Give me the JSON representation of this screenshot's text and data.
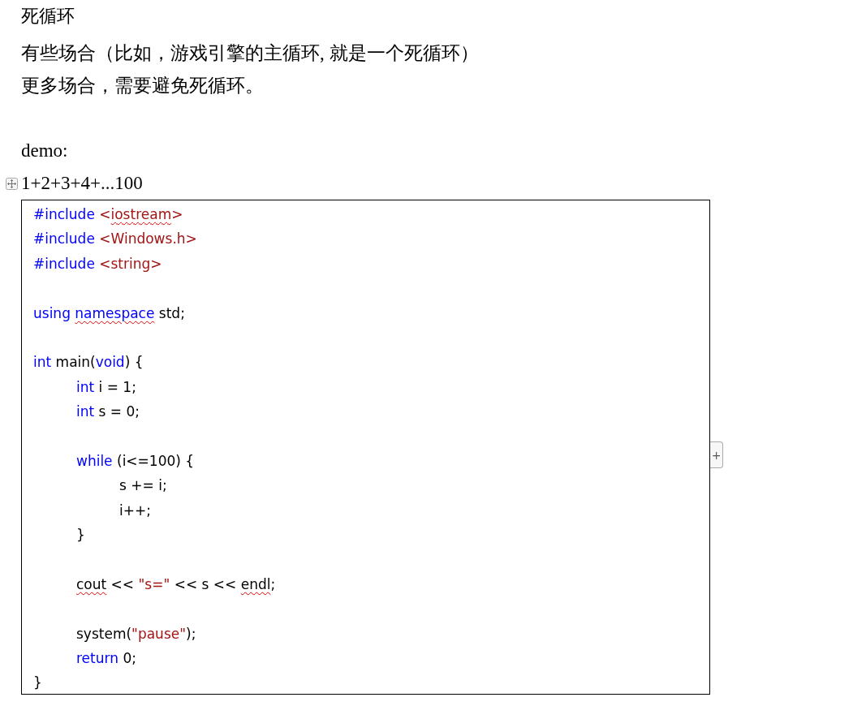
{
  "heading": "死循环",
  "paragraphs": [
    "有些场合（比如，游戏引擎的主循环, 就是一个死循环）",
    "更多场合，需要避免死循环。"
  ],
  "demo_label": "demo:",
  "formula": "1+2+3+4+...100",
  "table_handle": {
    "kind": "move"
  },
  "add_button": "+",
  "code": [
    {
      "kind": "code",
      "tokens": [
        {
          "t": "#include ",
          "kind": "keyword"
        },
        {
          "t": "<",
          "kind": "string"
        },
        {
          "t": "iostream",
          "kind": "string",
          "misspelled": true
        },
        {
          "t": ">",
          "kind": "string"
        }
      ]
    },
    {
      "kind": "code",
      "tokens": [
        {
          "t": "#include ",
          "kind": "keyword"
        },
        {
          "t": "<Windows.h>",
          "kind": "string"
        }
      ]
    },
    {
      "kind": "code",
      "tokens": [
        {
          "t": "#include ",
          "kind": "keyword"
        },
        {
          "t": "<string>",
          "kind": "string"
        }
      ]
    },
    {
      "kind": "blank"
    },
    {
      "kind": "code",
      "tokens": [
        {
          "t": "using ",
          "kind": "keyword"
        },
        {
          "t": "namespace",
          "kind": "keyword",
          "misspelled": true
        },
        {
          "t": " std;",
          "kind": "plain"
        }
      ]
    },
    {
      "kind": "blank"
    },
    {
      "kind": "code",
      "tokens": [
        {
          "t": "int",
          "kind": "keyword"
        },
        {
          "t": " main(",
          "kind": "plain"
        },
        {
          "t": "void",
          "kind": "keyword"
        },
        {
          "t": ") {",
          "kind": "plain"
        }
      ],
      "children": [
        {
          "kind": "code",
          "tokens": [
            {
              "t": "int",
              "kind": "keyword"
            },
            {
              "t": " i = 1;",
              "kind": "plain"
            }
          ]
        },
        {
          "kind": "code",
          "tokens": [
            {
              "t": "int",
              "kind": "keyword"
            },
            {
              "t": " s = 0;",
              "kind": "plain"
            }
          ]
        },
        {
          "kind": "blank"
        },
        {
          "kind": "code",
          "tokens": [
            {
              "t": "while",
              "kind": "keyword"
            },
            {
              "t": " (i<=100) {",
              "kind": "plain"
            }
          ],
          "children": [
            {
              "kind": "code",
              "tokens": [
                {
                  "t": "s += i;",
                  "kind": "plain"
                }
              ]
            },
            {
              "kind": "code",
              "tokens": [
                {
                  "t": "i++;",
                  "kind": "plain"
                }
              ]
            }
          ]
        },
        {
          "kind": "code",
          "tokens": [
            {
              "t": "}",
              "kind": "plain"
            }
          ]
        },
        {
          "kind": "blank"
        },
        {
          "kind": "code",
          "tokens": [
            {
              "t": "cout",
              "kind": "plain",
              "misspelled": true
            },
            {
              "t": " << ",
              "kind": "plain"
            },
            {
              "t": "\"s=\"",
              "kind": "string"
            },
            {
              "t": " << s << ",
              "kind": "plain"
            },
            {
              "t": "endl",
              "kind": "plain",
              "misspelled": true
            },
            {
              "t": ";",
              "kind": "plain"
            }
          ]
        },
        {
          "kind": "blank"
        },
        {
          "kind": "code",
          "tokens": [
            {
              "t": "system(",
              "kind": "plain"
            },
            {
              "t": "\"pause\"",
              "kind": "string"
            },
            {
              "t": ");",
              "kind": "plain"
            }
          ]
        },
        {
          "kind": "code",
          "tokens": [
            {
              "t": "return",
              "kind": "keyword"
            },
            {
              "t": " 0;",
              "kind": "plain"
            }
          ]
        }
      ]
    },
    {
      "kind": "code",
      "tokens": [
        {
          "t": "}",
          "kind": "plain"
        }
      ]
    }
  ]
}
